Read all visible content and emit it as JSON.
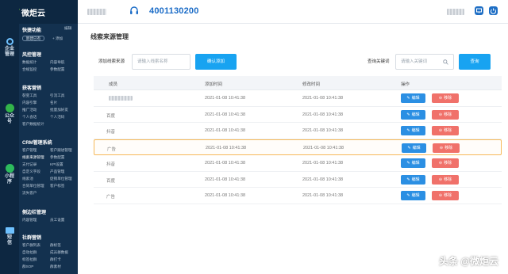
{
  "brand": {
    "name": "微炬云",
    "colors": {
      "sidebar": "#13314f",
      "rail": "#0d2741",
      "primary": "#18a3f1",
      "edit": "#2b8fe3",
      "remove": "#f0716a",
      "highlight_border": "#f6b95a"
    }
  },
  "rail": [
    {
      "label": "企业\n管理",
      "icon": "user-icon"
    },
    {
      "label": "公众\n号",
      "icon": "wechat-icon"
    },
    {
      "label": "小程\n序",
      "icon": "miniprogram-icon"
    },
    {
      "label": "短\n信",
      "icon": "mail-icon"
    }
  ],
  "sidebar": {
    "quick": {
      "title": "快捷功能",
      "edit": "编辑",
      "btn_new": "新建已有",
      "btn_add": "+ 添加"
    },
    "sections": [
      {
        "title": "风控管理",
        "items": [
          "数据统计",
          "内容导航",
          "合规监控",
          "参数配置"
        ]
      },
      {
        "title": "获客营销",
        "items": [
          "裂变工具",
          "引流工具",
          "内容引擎",
          "名片",
          "推广活动",
          "批量加好友",
          "个人会话",
          "个人活码",
          "客户数据统计"
        ]
      },
      {
        "title": "CRM管理系统",
        "items": [
          "客户管理",
          "客户跟进管理",
          "线索来源管理",
          "参数配置",
          "支付记录",
          "KPI设置",
          "自定义字段",
          "产品管理",
          "线索池",
          "促销单位管理",
          "合同单位管理",
          "客户标签",
          "流失客户"
        ]
      },
      {
        "title": "侧边栏管理",
        "items": [
          "内容管理",
          "员工设置"
        ]
      },
      {
        "title": "社群营销",
        "items": [
          "客户群列表",
          "群标签",
          "自动拉群",
          "成员群数据",
          "标签拉群",
          "群打卡",
          "群SOP",
          "群素材"
        ]
      }
    ]
  },
  "header": {
    "phone": "4001130200"
  },
  "page": {
    "title": "线索来源管理",
    "add_label": "添加线索来源",
    "add_placeholder": "请输入线索名称",
    "add_button": "确认添加",
    "search_label": "查询关键词",
    "search_placeholder": "请输入关键词",
    "search_button": "查询"
  },
  "table": {
    "columns": [
      "成员",
      "添加时间",
      "修改时间",
      "操作"
    ],
    "edit_label": "编辑",
    "remove_label": "移除",
    "rows": [
      {
        "member": "",
        "added": "2021-01-08 10:41:38",
        "modified": "2021-01-08 10:41:38"
      },
      {
        "member": "百度",
        "added": "2021-01-08 10:41:38",
        "modified": "2021-01-08 10:41:38"
      },
      {
        "member": "抖音",
        "added": "2021-01-08 10:41:38",
        "modified": "2021-01-08 10:41:38"
      },
      {
        "member": "广告",
        "added": "2021-01-08 10:41:38",
        "modified": "2021-01-08 10:41:38",
        "highlighted": true
      },
      {
        "member": "抖音",
        "added": "2021-01-08 10:41:38",
        "modified": "2021-01-08 10:41:38"
      },
      {
        "member": "百度",
        "added": "2021-01-08 10:41:38",
        "modified": "2021-01-08 10:41:38"
      },
      {
        "member": "广告",
        "added": "2021-01-08 10:41:38",
        "modified": "2021-01-08 10:41:38"
      }
    ]
  },
  "watermark": "头条 @微炬云"
}
